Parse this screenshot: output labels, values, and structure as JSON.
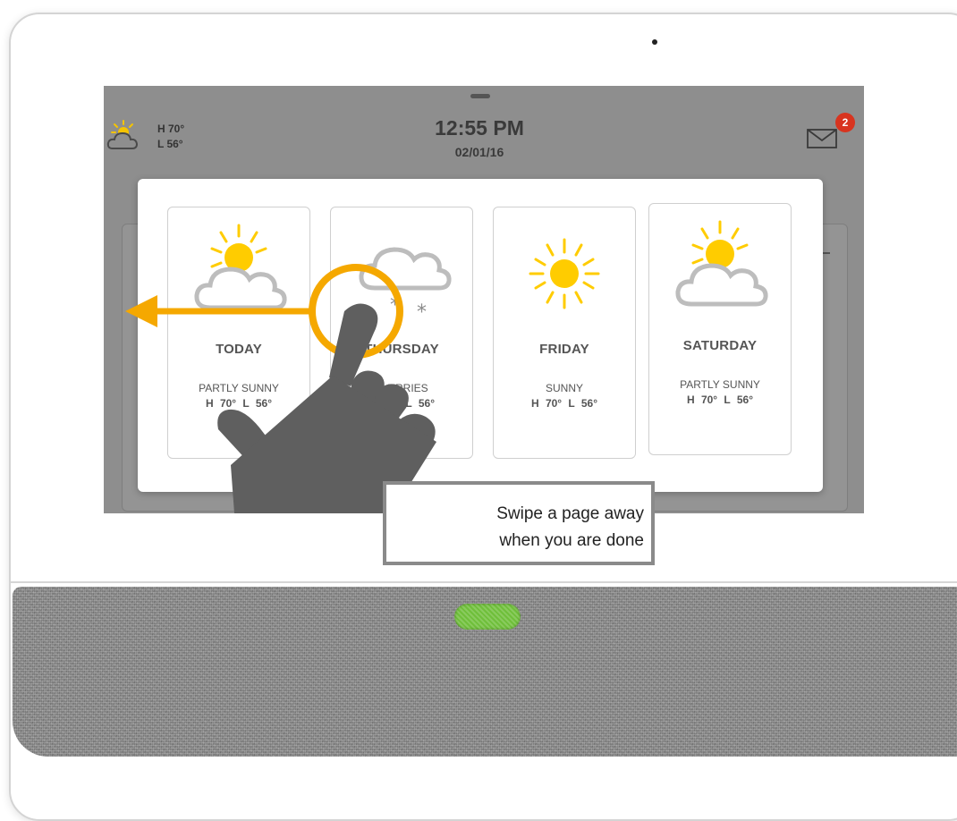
{
  "status_bar": {
    "weather_icon": "partly-sunny-icon",
    "high": "H 70°",
    "low": "L 56°",
    "time": "12:55 PM",
    "date": "02/01/16",
    "messages_icon": "envelope-icon",
    "message_count": "2"
  },
  "forecast": {
    "days": [
      {
        "name": "TODAY",
        "condition": "PARTLY SUNNY",
        "temps": "H 70° L 56°",
        "icon": "partly-sunny-icon"
      },
      {
        "name": "THURSDAY",
        "condition": "FLURRIES",
        "temps": "H 70° L 56°",
        "icon": "flurries-icon"
      },
      {
        "name": "FRIDAY",
        "condition": "SUNNY",
        "temps": "H 70° L 56°",
        "icon": "sunny-icon"
      },
      {
        "name": "SATURDAY",
        "condition": "PARTLY SUNNY",
        "temps": "H 70° L 56°",
        "icon": "partly-sunny-icon"
      }
    ]
  },
  "tutorial": {
    "caption_line1": "Swipe a page away",
    "caption_line2": "when you are done",
    "gesture_icon": "swipe-hand-icon",
    "arrow_icon": "arrow-left-icon"
  },
  "colors": {
    "accent_orange": "#f5a800",
    "sun_yellow": "#ffcc00",
    "badge_red": "#d8341f",
    "home_button_green": "#6fbf3a",
    "hand_gray": "#5f5f5f"
  }
}
